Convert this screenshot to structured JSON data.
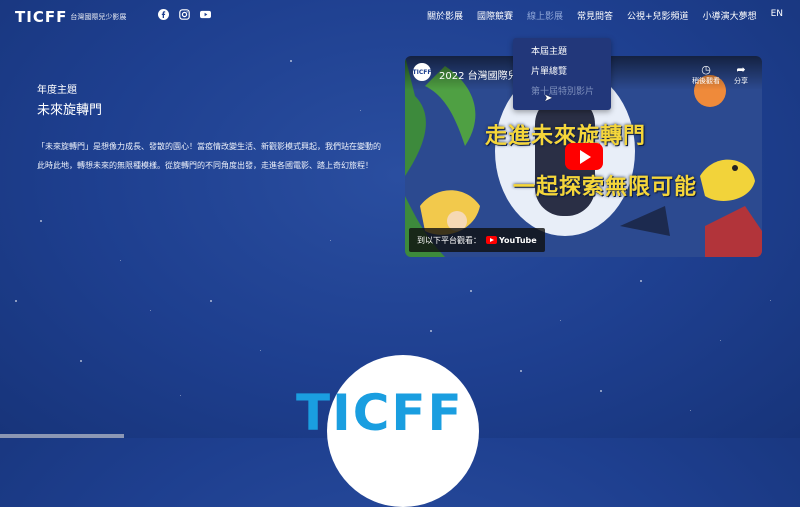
{
  "brand": {
    "logo_text": "TICFF",
    "logo_subtext": "台灣國際兒少影展"
  },
  "social": [
    "facebook-icon",
    "instagram-icon",
    "youtube-icon"
  ],
  "nav": [
    {
      "label": "關於影展"
    },
    {
      "label": "國際競賽"
    },
    {
      "label": "線上影展",
      "active": true
    },
    {
      "label": "常見問答"
    },
    {
      "label": "公視+兒影頻道"
    },
    {
      "label": "小導演大夢想"
    },
    {
      "label": "EN"
    }
  ],
  "dropdown": [
    "本屆主題",
    "片單總覽",
    "第十屆特別影片"
  ],
  "content": {
    "section_label": "年度主題",
    "theme_title": "未來旋轉門",
    "description": "「未來旋轉門」是想像力成長、發散的園心！當疫情改變生活、新觀影模式興起，我們站在變動的此時此地，轉想未來的無限種模樣。從旋轉門的不同角度出發，走進各國電影、踏上奇幻旅程！"
  },
  "video": {
    "title": "2022 台灣國際兒少影展",
    "watch_later": "稍後觀看",
    "share": "分享",
    "headline_1": "走進未來旋轉門",
    "headline_2": "一起探索無限可能",
    "watch_on": "到以下平台觀看：",
    "youtube": "YouTube"
  },
  "colors": {
    "background": "#1e3f8f",
    "accent_blue": "#1a9ee0",
    "headline_yellow": "#f5d63a",
    "play_red": "#ff0000"
  }
}
